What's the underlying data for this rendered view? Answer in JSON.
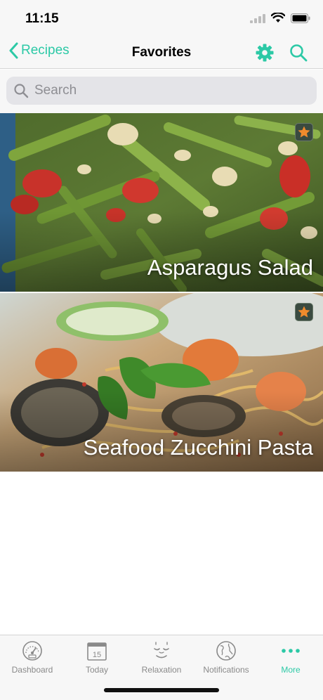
{
  "status": {
    "time": "11:15"
  },
  "nav": {
    "back_label": "Recipes",
    "title": "Favorites"
  },
  "search": {
    "placeholder": "Search"
  },
  "recipes": [
    {
      "title": "Asparagus Salad",
      "favorite": true
    },
    {
      "title": "Seafood Zucchini Pasta",
      "favorite": true
    }
  ],
  "tabs": [
    {
      "label": "Dashboard",
      "icon": "speedometer-icon"
    },
    {
      "label": "Today",
      "icon": "calendar-icon",
      "date": "15"
    },
    {
      "label": "Relaxation",
      "icon": "relaxed-face-icon"
    },
    {
      "label": "Notifications",
      "icon": "globe-icon"
    },
    {
      "label": "More",
      "icon": "ellipsis-icon",
      "active": true
    }
  ],
  "colors": {
    "accent": "#2cc9a6",
    "star": "#f08a2c",
    "tab_inactive": "#8a8a8a"
  }
}
